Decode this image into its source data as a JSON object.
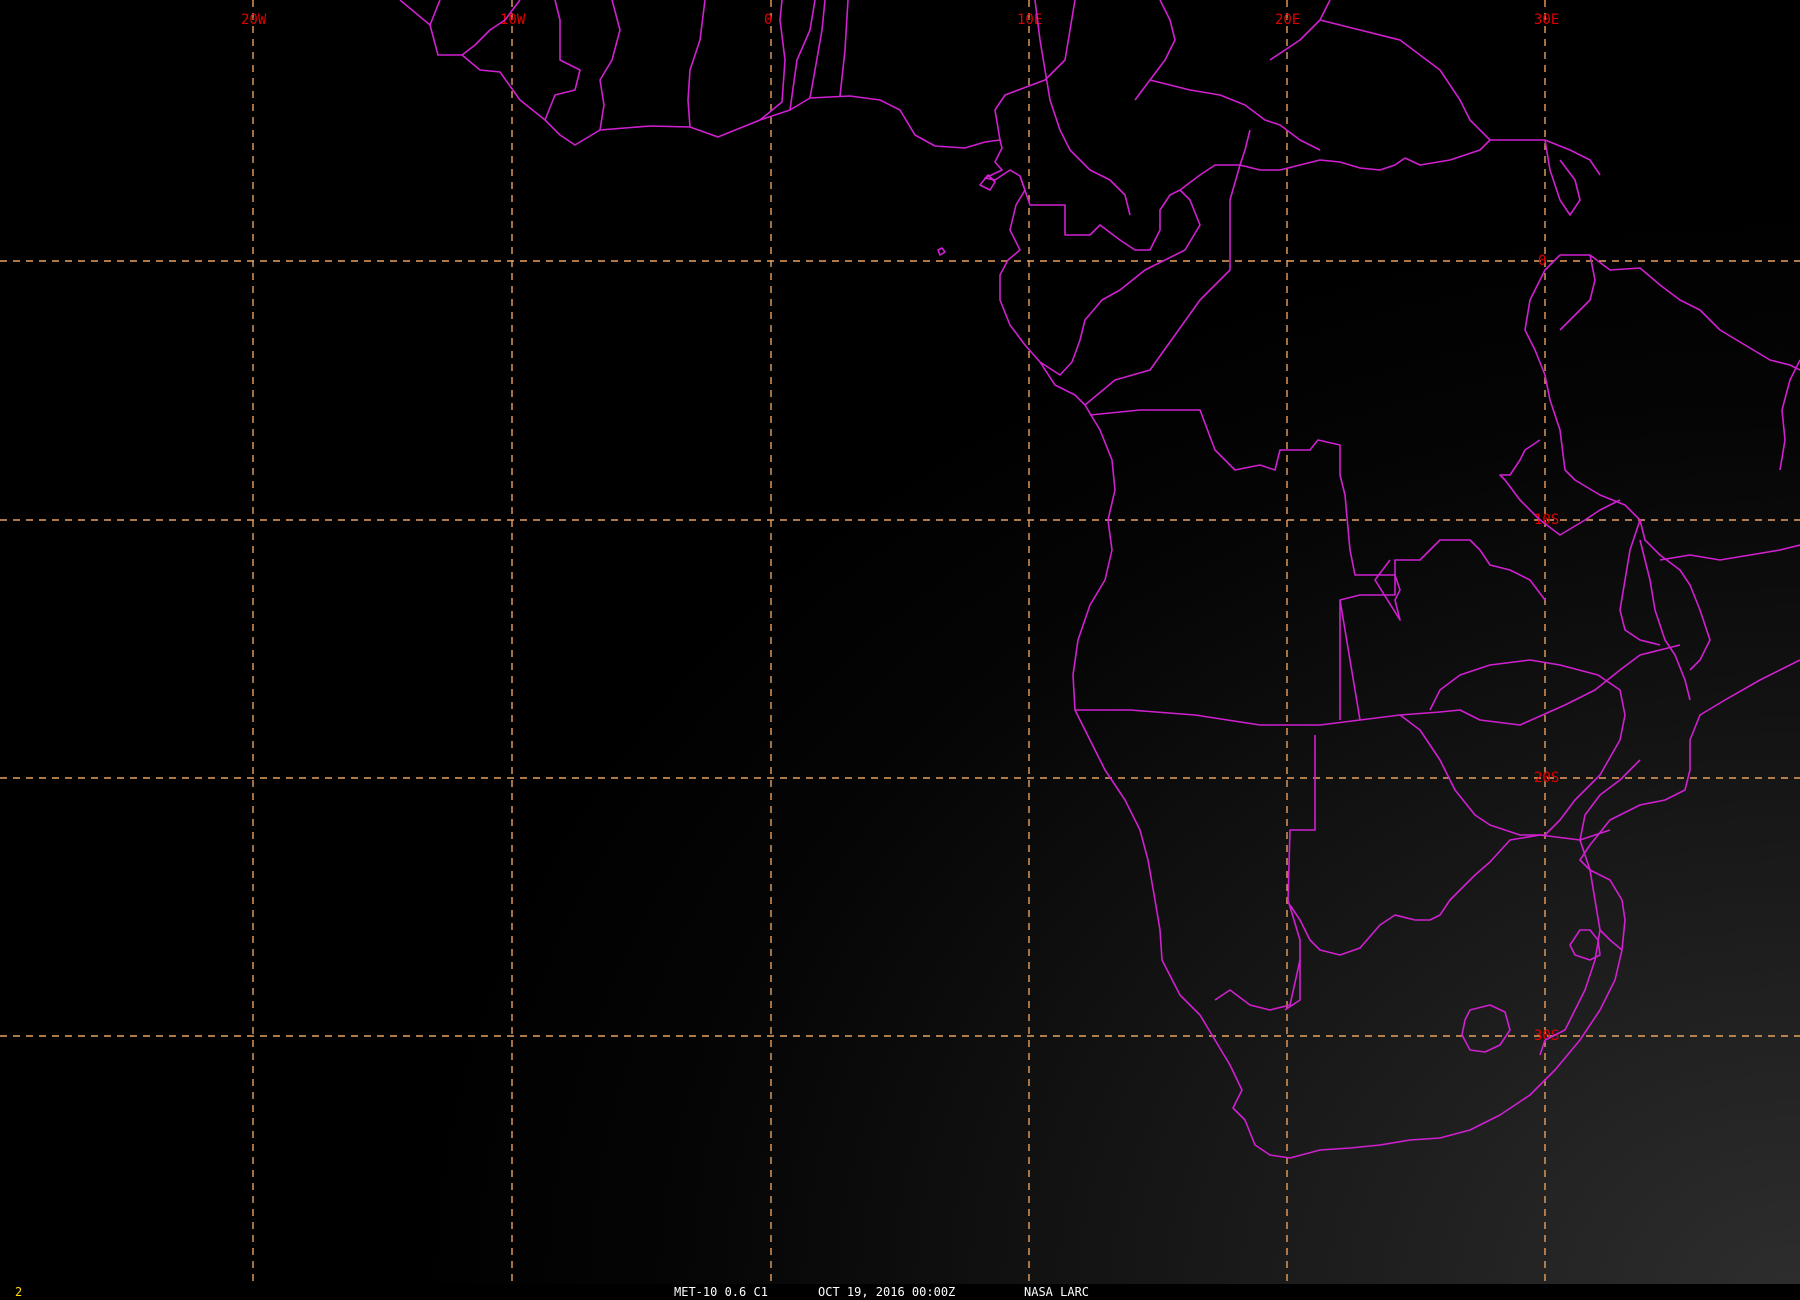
{
  "viewer": {
    "frame_number": "2",
    "caption": {
      "sensor": "MET-10 0.6 C1",
      "datetime": "OCT 19, 2016 00:00Z",
      "source": "NASA LARC"
    }
  },
  "grid": {
    "longitude_labels": [
      "20W",
      "10W",
      "0",
      "10E",
      "20E",
      "30E"
    ],
    "latitude_labels": [
      "0",
      "10S",
      "20S",
      "30S"
    ]
  },
  "colors": {
    "boundary": "#d020d0",
    "gridline": "#e8a060",
    "grid_label": "#e00000",
    "frame_number": "#ffd800",
    "caption": "#ffffff"
  },
  "map": {
    "projection": "geostationary satellite view",
    "region": "southern Africa and South Atlantic",
    "layers": [
      "country-boundaries",
      "coastlines",
      "lat-lon-grid"
    ]
  }
}
